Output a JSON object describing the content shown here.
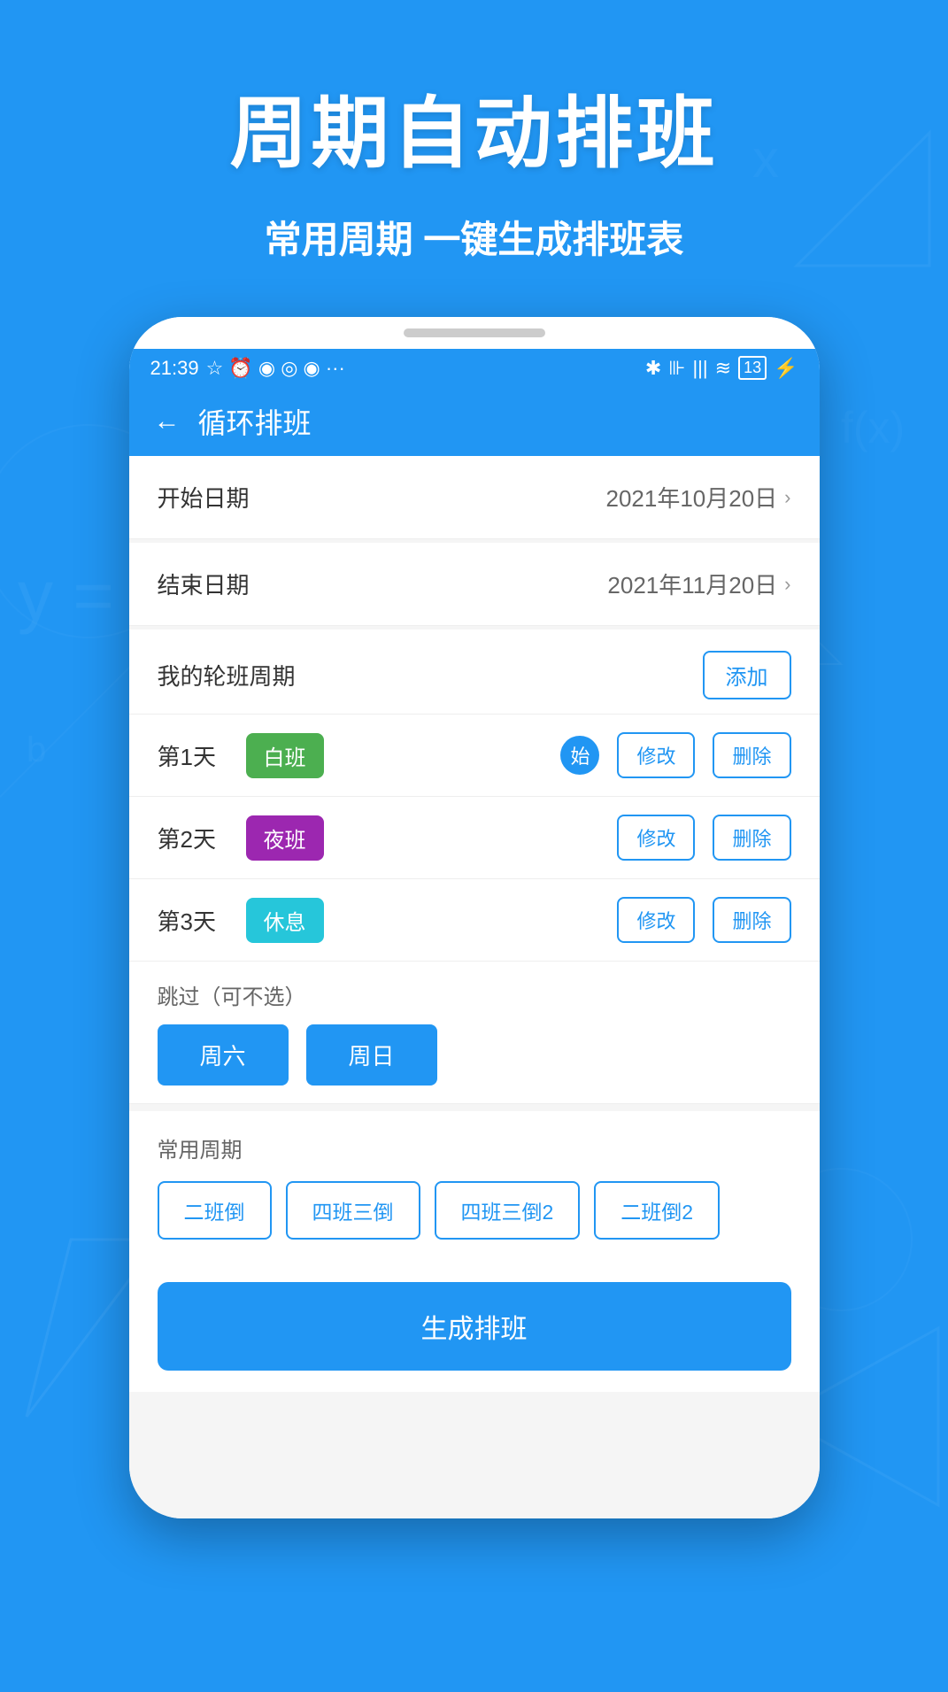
{
  "background": {
    "color": "#2196F3"
  },
  "header": {
    "title": "周期自动排班",
    "subtitle": "常用周期 一键生成排班表"
  },
  "statusBar": {
    "time": "21:39",
    "icons": "☆ ⏰ ◉ ◎ ◉ ···",
    "rightIcons": "* |||  ≋ 13"
  },
  "appHeader": {
    "backLabel": "←",
    "title": "循环排班"
  },
  "startDate": {
    "label": "开始日期",
    "value": "2021年10月20日"
  },
  "endDate": {
    "label": "结束日期",
    "value": "2021年11月20日"
  },
  "myRotation": {
    "label": "我的轮班周期",
    "addButton": "添加"
  },
  "shifts": [
    {
      "day": "第1天",
      "name": "白班",
      "badgeClass": "badge-white",
      "hasStart": true,
      "editLabel": "修改",
      "deleteLabel": "删除"
    },
    {
      "day": "第2天",
      "name": "夜班",
      "badgeClass": "badge-night",
      "hasStart": false,
      "editLabel": "修改",
      "deleteLabel": "删除"
    },
    {
      "day": "第3天",
      "name": "休息",
      "badgeClass": "badge-rest",
      "hasStart": false,
      "editLabel": "修改",
      "deleteLabel": "删除"
    }
  ],
  "skipSection": {
    "title": "跳过（可不选）",
    "buttons": [
      "周六",
      "周日"
    ]
  },
  "commonCycles": {
    "title": "常用周期",
    "buttons": [
      "二班倒",
      "四班三倒",
      "四班三倒2",
      "二班倒2"
    ]
  },
  "generateButton": "生成排班",
  "startCircleLabel": "始"
}
